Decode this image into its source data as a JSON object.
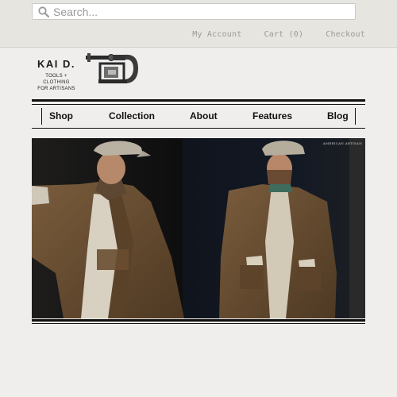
{
  "search": {
    "placeholder": "Search..."
  },
  "account": {
    "my_account": "My Account",
    "cart": "Cart (0)",
    "checkout": "Checkout"
  },
  "logo": {
    "name": "KAI D.",
    "tagline_line1": "TOOLS + CLOTHING",
    "tagline_line2": "FOR ARTISANS"
  },
  "nav": {
    "items": [
      {
        "label": "Shop"
      },
      {
        "label": "Collection"
      },
      {
        "label": "About"
      },
      {
        "label": "Features"
      },
      {
        "label": "Blog"
      }
    ]
  },
  "hero": {
    "caption": "AMERICAN ARTISAN"
  },
  "colors": {
    "page_background": "#efeeec",
    "header_background": "#e6e5df",
    "rule": "#111111",
    "jacket": "#6b5034"
  }
}
